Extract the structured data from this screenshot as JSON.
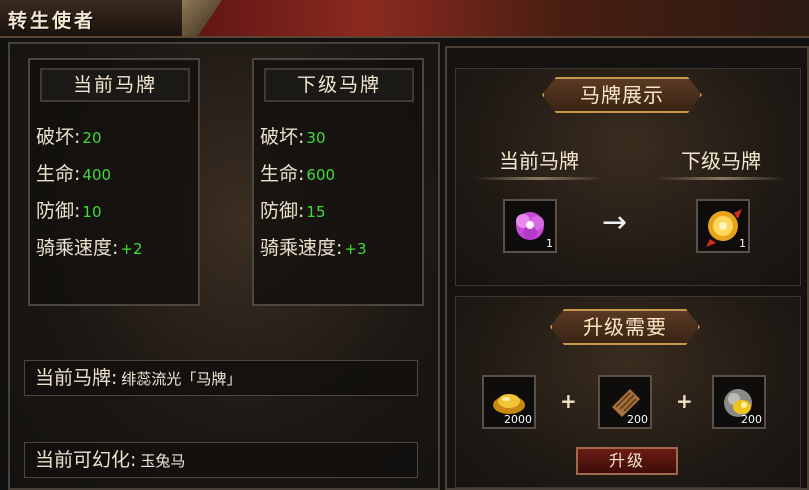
{
  "window": {
    "title": "转生使者"
  },
  "current_stats": {
    "header": "当前马牌",
    "rows": [
      {
        "label": "破坏:",
        "value": "20"
      },
      {
        "label": "生命:",
        "value": "400"
      },
      {
        "label": "防御:",
        "value": "10"
      },
      {
        "label": "骑乘速度:",
        "value": "+2"
      }
    ]
  },
  "next_stats": {
    "header": "下级马牌",
    "rows": [
      {
        "label": "破坏:",
        "value": "30"
      },
      {
        "label": "生命:",
        "value": "600"
      },
      {
        "label": "防御:",
        "value": "15"
      },
      {
        "label": "骑乘速度:",
        "value": "+3"
      }
    ]
  },
  "current_card": {
    "label": "当前马牌:",
    "value": "绯蕊流光「马牌」"
  },
  "current_transform": {
    "label": "当前可幻化:",
    "value": "玉兔马"
  },
  "display": {
    "title": "马牌展示",
    "current_label": "当前马牌",
    "next_label": "下级马牌",
    "current_item_count": "1",
    "next_item_count": "1",
    "arrow": "→"
  },
  "upgrade": {
    "title": "升级需要",
    "materials": [
      {
        "icon": "gold-ingot-icon",
        "count": "2000"
      },
      {
        "icon": "scroll-material-icon",
        "count": "200"
      },
      {
        "icon": "gold-ore-icon",
        "count": "200"
      }
    ],
    "plus": "+",
    "button_label": "升级"
  },
  "colors": {
    "stat_value": "#3fdc3a",
    "ribbon_border": "#c8964d",
    "button_bg": "#6b1c14"
  }
}
